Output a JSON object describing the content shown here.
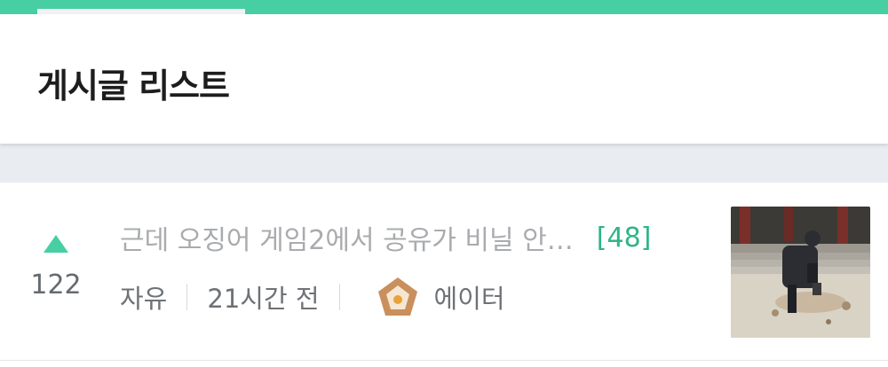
{
  "header": {
    "title": "게시글 리스트"
  },
  "post": {
    "vote_count": "122",
    "title": "근데 오징어 게임2에서 공유가 비닐 안…",
    "comment_count": "[48]",
    "category": "자유",
    "time": "21시간 전",
    "author": "에이터",
    "rank_icon": "bronze-pentagon-badge-icon"
  },
  "colors": {
    "accent": "#47cfa3",
    "comment": "#2fb488",
    "title": "#a9abae",
    "meta": "#6e7276",
    "separator_bg": "#e9edf1"
  }
}
